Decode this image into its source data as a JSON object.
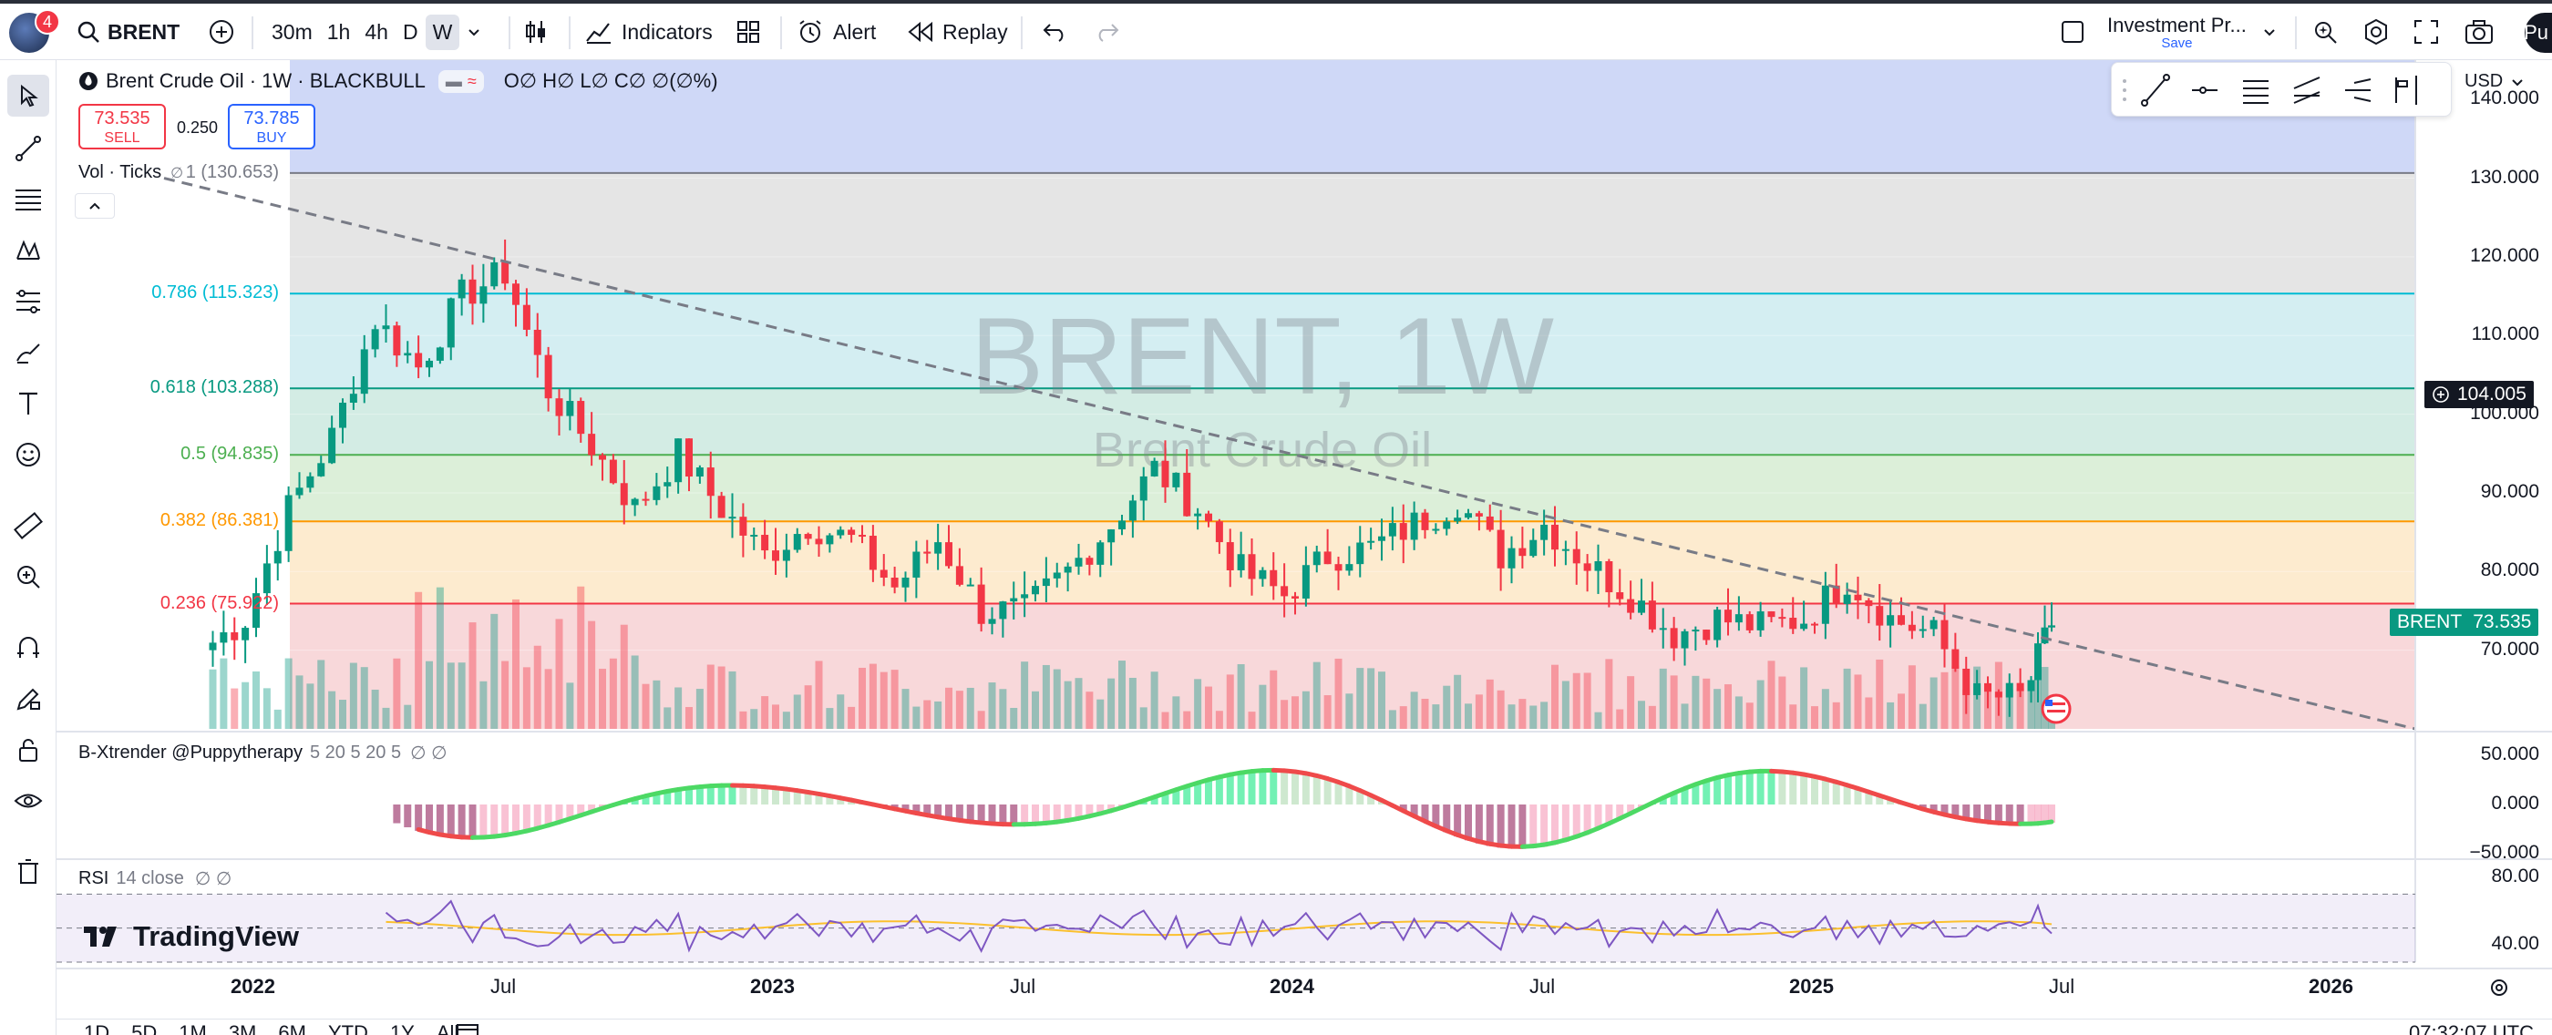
{
  "toolbar": {
    "notification_count": "4",
    "symbol": "BRENT",
    "intervals": [
      "30m",
      "1h",
      "4h",
      "D",
      "W"
    ],
    "active_interval": "W",
    "indicators_label": "Indicators",
    "alert_label": "Alert",
    "replay_label": "Replay",
    "layout_name": "Investment Pr...",
    "layout_save_label": "Save",
    "publish_label": "Pu"
  },
  "legend": {
    "title": "Brent Crude Oil · 1W · BLACKBULL",
    "ohlc": "O∅ H∅ L∅ C∅ ∅(∅%)",
    "sell_price": "73.535",
    "sell_label": "SELL",
    "spread": "0.250",
    "buy_price": "73.785",
    "buy_label": "BUY",
    "volume_label": "Vol · Ticks",
    "volume_hidden": "∅"
  },
  "watermark": {
    "symbol": "BRENT, 1W",
    "description": "Brent Crude Oil"
  },
  "currency": "USD",
  "price_axis": [
    "140.000",
    "130.000",
    "120.000",
    "110.000",
    "100.000",
    "90.000",
    "80.000",
    "70.000"
  ],
  "crosshair_price": "104.005",
  "last_price_label": "BRENT",
  "last_price": "73.535",
  "fibonacci": [
    {
      "label": "1 (130.653)",
      "level": 130.653,
      "color": "#787b86"
    },
    {
      "label": "0.786 (115.323)",
      "level": 115.323,
      "color": "#00bcd4"
    },
    {
      "label": "0.618 (103.288)",
      "level": 103.288,
      "color": "#089981"
    },
    {
      "label": "0.5 (94.835)",
      "level": 94.835,
      "color": "#4caf50"
    },
    {
      "label": "0.382 (86.381)",
      "level": 86.381,
      "color": "#ff9800"
    },
    {
      "label": "0.236 (75.922)",
      "level": 75.922,
      "color": "#f23645"
    }
  ],
  "indicator_xtrender": {
    "name": "B-Xtrender @Puppytherapy",
    "params": "5 20 5 20 5",
    "flags": "∅ ∅",
    "axis": [
      "50.000",
      "0.000",
      "−50.000"
    ]
  },
  "indicator_rsi": {
    "name": "RSI",
    "params": "14 close",
    "flags": "∅ ∅",
    "axis": [
      "80.00",
      "40.00"
    ]
  },
  "time_axis": [
    {
      "label": "2022",
      "bold": true
    },
    {
      "label": "Jul",
      "bold": false
    },
    {
      "label": "2023",
      "bold": true
    },
    {
      "label": "Jul",
      "bold": false
    },
    {
      "label": "2024",
      "bold": true
    },
    {
      "label": "Jul",
      "bold": false
    },
    {
      "label": "2025",
      "bold": true
    },
    {
      "label": "Jul",
      "bold": false
    },
    {
      "label": "2026",
      "bold": true
    }
  ],
  "branding": "TradingView",
  "bottom_ranges": [
    "1D",
    "5D",
    "1M",
    "3M",
    "6M",
    "YTD",
    "1Y",
    "All"
  ],
  "clock": "07:32:07 UTC",
  "colors": {
    "up": "#089981",
    "down": "#f23645",
    "trendline": "#787b86"
  },
  "chart_data": {
    "type": "candlestick",
    "title": "Brent Crude Oil · 1W · BLACKBULL",
    "xlabel": "",
    "ylabel": "",
    "ylim": [
      60,
      145
    ],
    "x_start": "2021-11",
    "x_end": "2026-03",
    "weekly_close_approx": [
      {
        "date": "2021-12",
        "close": 74
      },
      {
        "date": "2022-01",
        "close": 88
      },
      {
        "date": "2022-02",
        "close": 97
      },
      {
        "date": "2022-03",
        "close": 112
      },
      {
        "date": "2022-04",
        "close": 106
      },
      {
        "date": "2022-05",
        "close": 115
      },
      {
        "date": "2022-06",
        "close": 118
      },
      {
        "date": "2022-07",
        "close": 103
      },
      {
        "date": "2022-08",
        "close": 96
      },
      {
        "date": "2022-09",
        "close": 88
      },
      {
        "date": "2022-10",
        "close": 95
      },
      {
        "date": "2022-11",
        "close": 88
      },
      {
        "date": "2022-12",
        "close": 82
      },
      {
        "date": "2023-01",
        "close": 86
      },
      {
        "date": "2023-02",
        "close": 84
      },
      {
        "date": "2023-03",
        "close": 78
      },
      {
        "date": "2023-04",
        "close": 84
      },
      {
        "date": "2023-05",
        "close": 75
      },
      {
        "date": "2023-06",
        "close": 75
      },
      {
        "date": "2023-07",
        "close": 80
      },
      {
        "date": "2023-08",
        "close": 86
      },
      {
        "date": "2023-09",
        "close": 93
      },
      {
        "date": "2023-10",
        "close": 88
      },
      {
        "date": "2023-11",
        "close": 80
      },
      {
        "date": "2023-12",
        "close": 77
      },
      {
        "date": "2024-01",
        "close": 82
      },
      {
        "date": "2024-02",
        "close": 83
      },
      {
        "date": "2024-03",
        "close": 86
      },
      {
        "date": "2024-04",
        "close": 89
      },
      {
        "date": "2024-05",
        "close": 82
      },
      {
        "date": "2024-06",
        "close": 86
      },
      {
        "date": "2024-07",
        "close": 81
      },
      {
        "date": "2024-08",
        "close": 77
      },
      {
        "date": "2024-09",
        "close": 72
      },
      {
        "date": "2024-10",
        "close": 74
      },
      {
        "date": "2024-11",
        "close": 73
      },
      {
        "date": "2024-12",
        "close": 74
      },
      {
        "date": "2025-01",
        "close": 79
      },
      {
        "date": "2025-02",
        "close": 74
      },
      {
        "date": "2025-03",
        "close": 72
      },
      {
        "date": "2025-04",
        "close": 64
      },
      {
        "date": "2025-05",
        "close": 64
      },
      {
        "date": "2025-06",
        "close": 73.535
      }
    ],
    "trendline": [
      {
        "date": "2021-11",
        "price": 130
      },
      {
        "date": "2026-03",
        "price": 60
      }
    ],
    "xtrender_ylim": [
      -60,
      60
    ],
    "rsi_ylim": [
      30,
      90
    ]
  }
}
